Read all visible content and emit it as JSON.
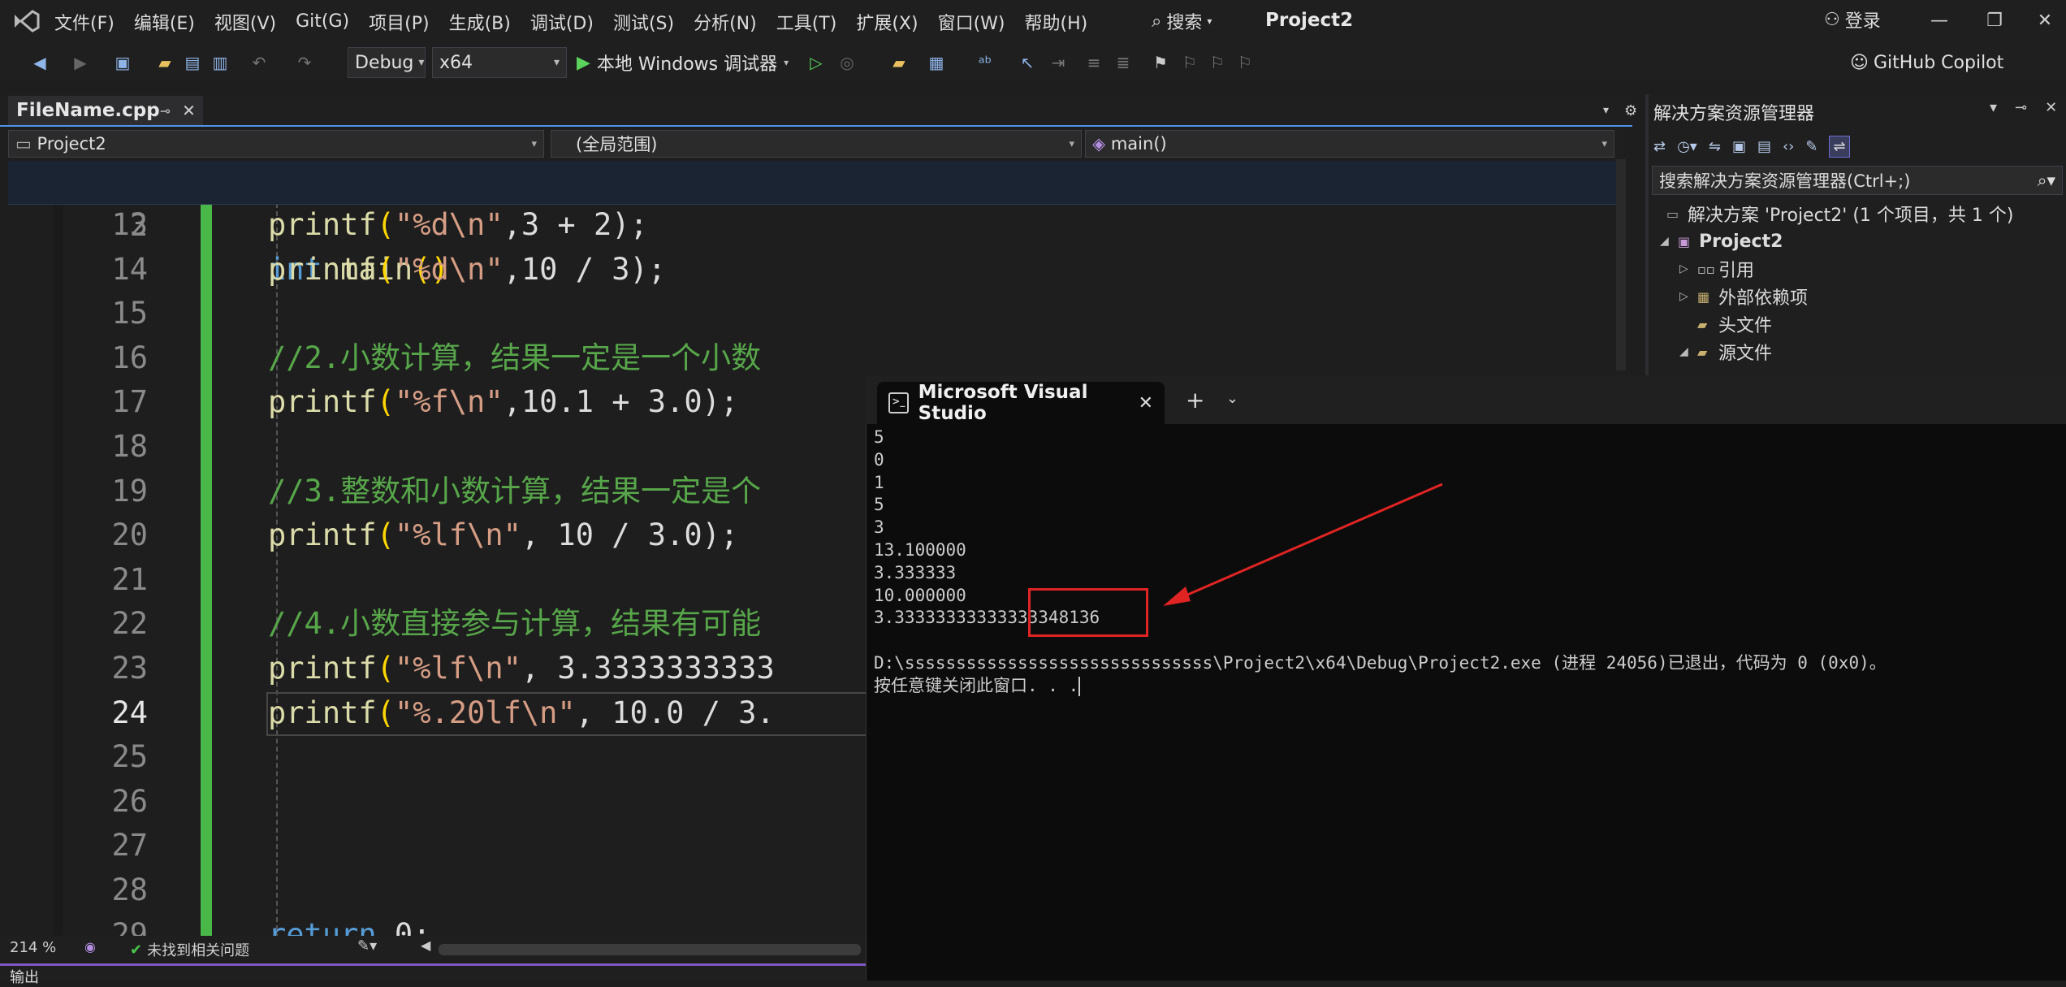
{
  "menu": [
    "文件(F)",
    "编辑(E)",
    "视图(V)",
    "Git(G)",
    "项目(P)",
    "生成(B)",
    "调试(D)",
    "测试(S)",
    "分析(N)",
    "工具(T)",
    "扩展(X)",
    "窗口(W)",
    "帮助(H)"
  ],
  "search_label": "搜索",
  "project_title": "Project2",
  "login": "登录",
  "toolbar": {
    "config": "Debug",
    "platform": "x64",
    "run_label": "本地 Windows 调试器",
    "copilot": "GitHub Copilot"
  },
  "editor": {
    "file_tab": "FileName.cpp",
    "nav_project": "Project2",
    "nav_scope": "(全局范围)",
    "nav_member": "main()",
    "sticky": {
      "ln": "2",
      "code": {
        "kw": "int",
        "fn": "main",
        "parens": "()"
      }
    },
    "lines": [
      {
        "ln": "13",
        "fn": "printf",
        "fmt": "\"%d\\n\"",
        "rest": ",3 + 2",
        "end": ");"
      },
      {
        "ln": "14",
        "fn": "printf",
        "fmt": "\"%d\\n\"",
        "rest": ",10 / 3",
        "end": ");"
      },
      {
        "ln": "15"
      },
      {
        "ln": "16",
        "comment": "//2.小数计算，结果一定是一个小数"
      },
      {
        "ln": "17",
        "fn": "printf",
        "fmt": "\"%f\\n\"",
        "rest": ",10.1 + 3.0",
        "end": ");"
      },
      {
        "ln": "18"
      },
      {
        "ln": "19",
        "comment": "//3.整数和小数计算，结果一定是个"
      },
      {
        "ln": "20",
        "fn": "printf",
        "fmt": "\"%lf\\n\"",
        "rest": ", 10 / 3.0",
        "end": ");"
      },
      {
        "ln": "21"
      },
      {
        "ln": "22",
        "comment": "//4.小数直接参与计算，结果有可能"
      },
      {
        "ln": "23",
        "fn": "printf",
        "fmt": "\"%lf\\n\"",
        "rest": ", 3.3333333333",
        "end": ""
      },
      {
        "ln": "24",
        "fn": "printf",
        "fmt": "\"%.20lf\\n\"",
        "rest": ", 10.0 / 3.",
        "end": ""
      },
      {
        "ln": "25"
      },
      {
        "ln": "26"
      },
      {
        "ln": "27"
      },
      {
        "ln": "28"
      },
      {
        "ln": "29",
        "kw": "return",
        "rest": " 0;"
      }
    ],
    "current_line": "24"
  },
  "status": {
    "zoom": "214 %",
    "issues": "未找到相关问题",
    "bottom_tab": "输出"
  },
  "solution_explorer": {
    "title": "解决方案资源管理器",
    "search_placeholder": "搜索解决方案资源管理器(Ctrl+;)",
    "tree": [
      {
        "label": "解决方案 'Project2' (1 个项目，共 1 个)"
      },
      {
        "label": "Project2"
      },
      {
        "label": "引用"
      },
      {
        "label": "外部依赖项"
      },
      {
        "label": "头文件"
      },
      {
        "label": "源文件"
      }
    ]
  },
  "console": {
    "tab_title": "Microsoft Visual Studio",
    "lines": [
      "5",
      "0",
      "1",
      "5",
      "3",
      "13.100000",
      "3.333333",
      "10.000000",
      "3.33333333333333348136",
      "",
      "D:\\ssssssssssssssssssssssssssssss\\Project2\\x64\\Debug\\Project2.exe (进程 24056)已退出，代码为 0 (0x0)。",
      "按任意键关闭此窗口. . ."
    ]
  },
  "colors": {
    "accent_blue": "#4f93e8",
    "change_bar": "#4ab848",
    "annotation_red": "#e02424"
  }
}
